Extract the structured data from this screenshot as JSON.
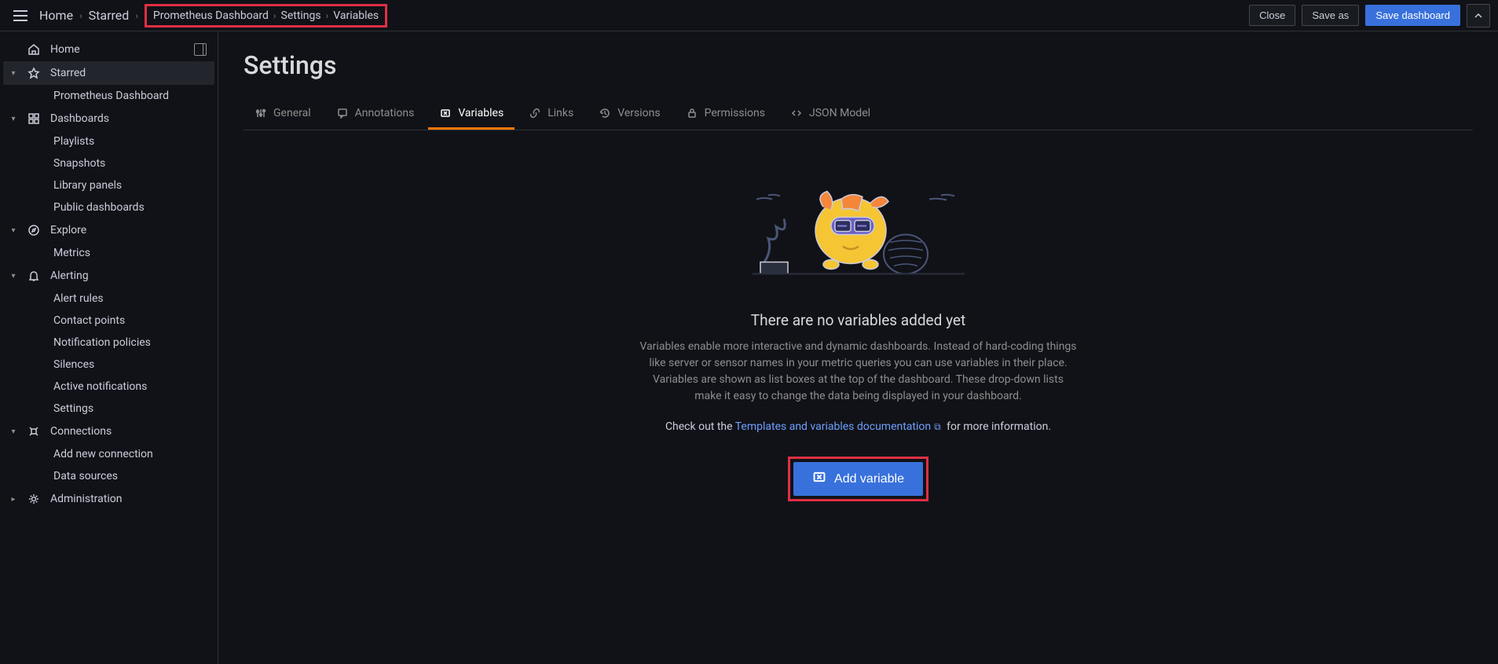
{
  "breadcrumb": {
    "items": [
      "Home",
      "Starred",
      "Prometheus Dashboard",
      "Settings",
      "Variables"
    ]
  },
  "topbar": {
    "close": "Close",
    "save_as": "Save as",
    "save_dashboard": "Save dashboard"
  },
  "sidebar": {
    "home": "Home",
    "starred": "Starred",
    "starred_items": [
      "Prometheus Dashboard"
    ],
    "dashboards": "Dashboards",
    "dashboards_items": [
      "Playlists",
      "Snapshots",
      "Library panels",
      "Public dashboards"
    ],
    "explore": "Explore",
    "explore_items": [
      "Metrics"
    ],
    "alerting": "Alerting",
    "alerting_items": [
      "Alert rules",
      "Contact points",
      "Notification policies",
      "Silences",
      "Active notifications",
      "Settings"
    ],
    "connections": "Connections",
    "connections_items": [
      "Add new connection",
      "Data sources"
    ],
    "administration": "Administration"
  },
  "page": {
    "title": "Settings"
  },
  "tabs": {
    "general": "General",
    "annotations": "Annotations",
    "variables": "Variables",
    "links": "Links",
    "versions": "Versions",
    "permissions": "Permissions",
    "json_model": "JSON Model"
  },
  "empty": {
    "title": "There are no variables added yet",
    "description": "Variables enable more interactive and dynamic dashboards. Instead of hard-coding things like server or sensor names in your metric queries you can use variables in their place. Variables are shown as list boxes at the top of the dashboard. These drop-down lists make it easy to change the data being displayed in your dashboard.",
    "check_out": "Check out the ",
    "doc_link": "Templates and variables documentation",
    "more_info": " for more information.",
    "cta": "Add variable"
  }
}
